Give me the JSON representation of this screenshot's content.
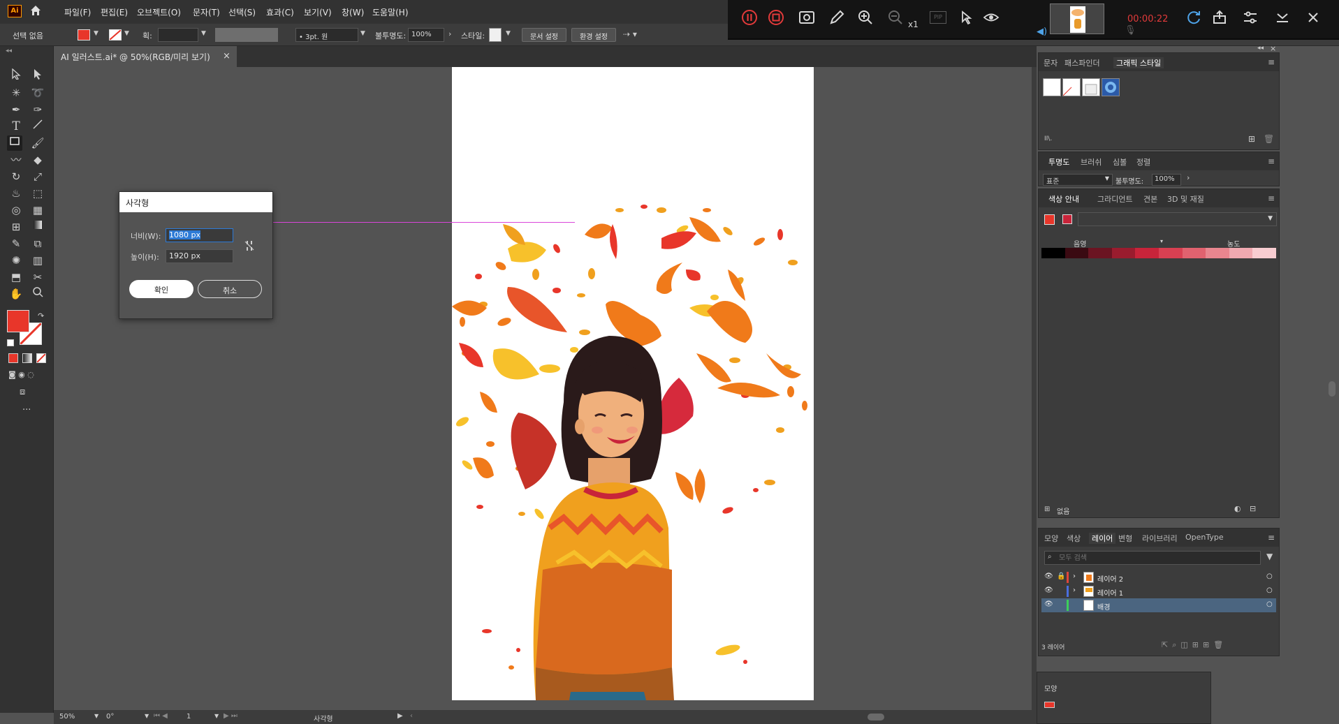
{
  "app": {
    "logo": "Ai",
    "home_icon": "home-icon"
  },
  "menu": [
    "파일(F)",
    "편집(E)",
    "오브젝트(O)",
    "문자(T)",
    "선택(S)",
    "효과(C)",
    "보기(V)",
    "창(W)",
    "도움말(H)"
  ],
  "control_bar": {
    "selection": "선택 없음",
    "stroke_label": "획:",
    "brush_value": "3pt. 원",
    "opacity_label": "불투명도:",
    "opacity_value": "100%",
    "style_label": "스타일:",
    "doc_setup": "문서 설정",
    "prefs": "환경 설정",
    "fill_color": "#e8362a"
  },
  "recorder": {
    "timer": "00:00:22",
    "zoom_multiplier": "x1",
    "pip_label": "PIP"
  },
  "document_tab": {
    "title": "AI 일러스트.ai* @ 50%(RGB/미리 보기)",
    "close": "×"
  },
  "dialog": {
    "title": "사각형",
    "width_label": "너비(W):",
    "width_value": "1080 px",
    "height_label": "높이(H):",
    "height_value": "1920 px",
    "ok": "확인",
    "cancel": "취소"
  },
  "status_bar": {
    "zoom": "50%",
    "rotation": "0°",
    "artboard_num": "1",
    "tool_name": "사각형"
  },
  "panels": {
    "top_tabs": [
      "문자",
      "패스파인더",
      "그래픽 스타일"
    ],
    "transparency_tabs": [
      "투명도",
      "브러쉬",
      "심볼",
      "정렬"
    ],
    "blend_mode": "표준",
    "opacity_label": "불투명도:",
    "opacity_value": "100%",
    "color_guide_tabs": [
      "색상 안내",
      "그라디언트",
      "견본",
      "3D 및 재질"
    ],
    "guide_labels": [
      "음영",
      "농도"
    ],
    "guide_footer": "없음",
    "guide_swatches": [
      "#000000",
      "#3a0a12",
      "#6b1422",
      "#9a1c2e",
      "#c8243a",
      "#d94052",
      "#e1626f",
      "#e9868f",
      "#f0a9b0",
      "#f8cdd1"
    ],
    "layer_tabs": [
      "모양",
      "색상",
      "레이어",
      "변형",
      "라이브러리",
      "OpenType"
    ],
    "layer_search_placeholder": "모두 검색",
    "layers": [
      {
        "name": "레이어 2",
        "color": "#e0443a"
      },
      {
        "name": "레이어 1",
        "color": "#4a6ee0"
      },
      {
        "name": "배경",
        "color": "#3ccf5a"
      }
    ],
    "layer_count": "3 레이어",
    "lower_panel_title": "모양"
  }
}
